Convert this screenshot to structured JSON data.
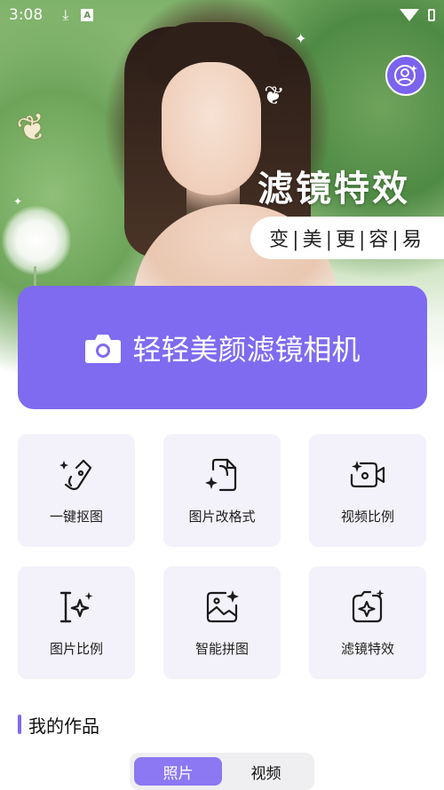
{
  "status_bar": {
    "time": "3:08",
    "icons": [
      "download-icon",
      "a-notification-icon",
      "wifi-icon",
      "battery-icon"
    ],
    "a_glyph": "A"
  },
  "hero": {
    "title": "滤镜特效",
    "subtitle": "变|美|更|容|易",
    "profile_icon": "user-sparkle-icon"
  },
  "camera_button": {
    "label": "轻轻美颜滤镜相机",
    "icon": "camera-icon"
  },
  "features": [
    {
      "label": "一键抠图",
      "icon": "magic-cutout-icon"
    },
    {
      "label": "图片改格式",
      "icon": "file-convert-icon"
    },
    {
      "label": "视频比例",
      "icon": "video-ratio-icon"
    },
    {
      "label": "图片比例",
      "icon": "image-ratio-icon"
    },
    {
      "label": "智能拼图",
      "icon": "smart-collage-icon"
    },
    {
      "label": "滤镜特效",
      "icon": "filter-effect-icon"
    }
  ],
  "works": {
    "title": "我的作品",
    "tabs": [
      {
        "label": "照片",
        "active": true
      },
      {
        "label": "视频",
        "active": false
      }
    ]
  },
  "colors": {
    "accent": "#7f6bf0",
    "tile_bg": "#f3f2fa"
  }
}
